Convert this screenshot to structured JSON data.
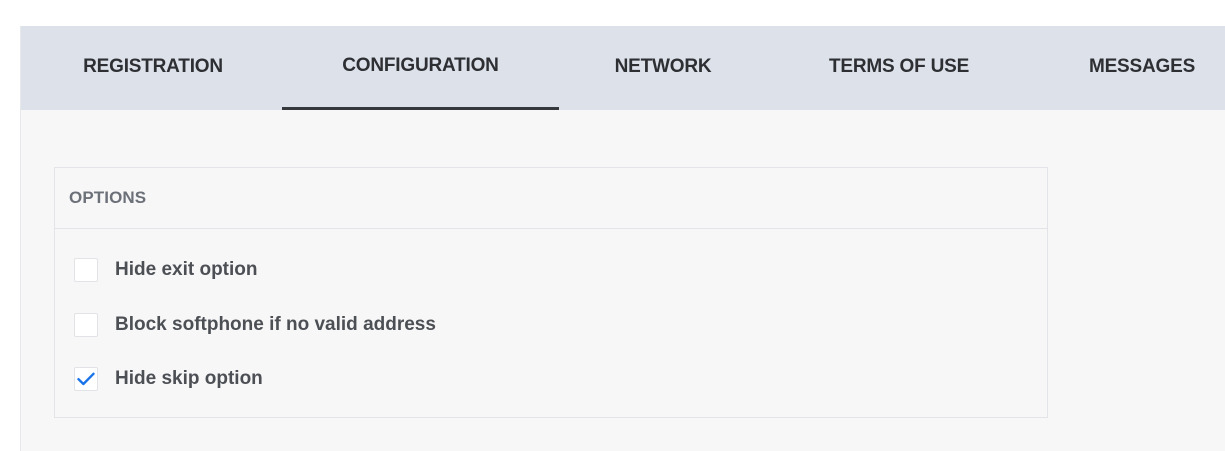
{
  "tabs": [
    {
      "label": "REGISTRATION",
      "active": false
    },
    {
      "label": "CONFIGURATION",
      "active": true
    },
    {
      "label": "NETWORK",
      "active": false
    },
    {
      "label": "TERMS OF USE",
      "active": false
    },
    {
      "label": "MESSAGES",
      "active": false
    }
  ],
  "options_panel": {
    "title": "OPTIONS",
    "items": [
      {
        "label": "Hide exit option",
        "checked": false
      },
      {
        "label": "Block softphone if no valid address",
        "checked": false
      },
      {
        "label": "Hide skip option",
        "checked": true
      }
    ]
  },
  "colors": {
    "tab_bar_bg": "#dde1ea",
    "active_tab_underline": "#35383d",
    "checkbox_check": "#1a73e8",
    "panel_title": "#6b7079"
  }
}
